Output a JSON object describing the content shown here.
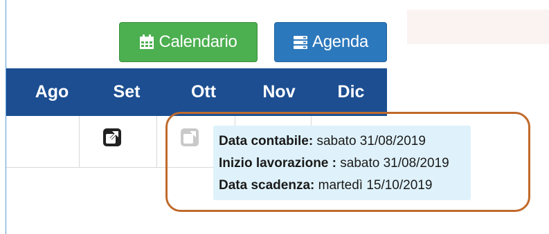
{
  "toolbar": {
    "calendar_label": "Calendario",
    "agenda_label": "Agenda",
    "calendar_icon": "calendar-icon",
    "agenda_icon": "list-icon"
  },
  "months": [
    "Ago",
    "Set",
    "Ott",
    "Nov",
    "Dic"
  ],
  "row_icons": {
    "set": "external-link-icon",
    "ott": "external-link-icon"
  },
  "tooltip": {
    "line1_label": "Data contabile:",
    "line1_value": " sabato 31/08/2019",
    "line2_label": "Inizio lavorazione :",
    "line2_value": " sabato 31/08/2019",
    "line3_label": "Data scadenza:",
    "line3_value": " martedì 15/10/2019"
  },
  "colors": {
    "month_bar": "#1c4e91",
    "calendar_button": "#4caf50",
    "agenda_button": "#2c78bd",
    "tooltip_bg": "#dff2fb",
    "highlight_frame": "#c06a2b"
  }
}
